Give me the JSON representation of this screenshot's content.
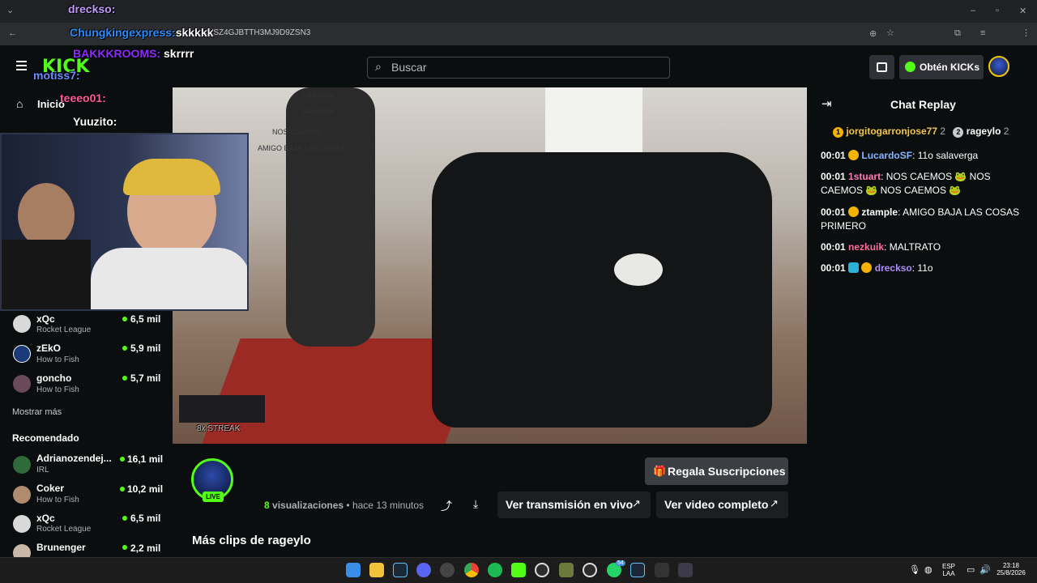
{
  "browser": {
    "url": "...kick.com/rageylo/clips/clip_...VYSZ4GJBTTH3MJ9D9ZSN3",
    "url_visible": "VYSZ4GJBTTH3MJ9D9ZSN3"
  },
  "header": {
    "search_placeholder": "Buscar",
    "kicks_label": "Obtén KICKs"
  },
  "sidebar": {
    "home_label": "Inicio",
    "channels": [
      {
        "name": "xQc",
        "game": "Rocket League",
        "viewers": "6,5 mil"
      },
      {
        "name": "zEkO",
        "game": "How to Fish",
        "viewers": "5,9 mil"
      },
      {
        "name": "goncho",
        "game": "How to Fish",
        "viewers": "5,7 mil"
      }
    ],
    "show_more": "Mostrar más",
    "recommended_title": "Recomendado",
    "recommended": [
      {
        "name": "Adrianozendej...",
        "game": "IRL",
        "viewers": "16,1 mil"
      },
      {
        "name": "Coker",
        "game": "How to Fish",
        "viewers": "10,2 mil"
      },
      {
        "name": "xQc",
        "game": "Rocket League",
        "viewers": "6,5 mil"
      },
      {
        "name": "Brunenger",
        "game": "",
        "viewers": "2,2 mil"
      }
    ]
  },
  "overlay_chat": [
    {
      "user": "drecksо:",
      "msg": "",
      "color": "#c39bff"
    },
    {
      "user": "Chungkingexpress:",
      "msg": "skkkkk",
      "color": "#2a8cff"
    },
    {
      "user": "BAKKKROOMS:",
      "msg": "skrrrr",
      "color": "#8e2bff"
    },
    {
      "user": "motiss7:",
      "msg": "",
      "color": "#6c8cff"
    },
    {
      "user": "teeeo01:",
      "msg": "",
      "color": "#ff5b9a"
    },
    {
      "user": "Yuuzito:",
      "msg": "",
      "color": "#ffffff"
    }
  ],
  "video_overlay": {
    "streak_label": "8x STREAK",
    "chat_lines": [
      "salaverga",
      "salaverga",
      "NOS CAEMOS",
      "AMIGO BAJA LAS COSAS"
    ]
  },
  "clip": {
    "live_badge": "LIVE",
    "gift_label": "Regala Suscripciones",
    "views_count": "8",
    "views_label": "visualizaciones",
    "time_ago": "• hace 13 minutos",
    "watch_live_label": "Ver transmisión en vivo",
    "watch_full_label": "Ver video completo",
    "more_clips_title": "Más clips de rageylo"
  },
  "chat": {
    "title": "Chat Replay",
    "pinned": [
      {
        "rank": "1",
        "user": "jorgitogarronjose77",
        "count": "2"
      },
      {
        "rank": "2",
        "user": "rageylo",
        "count": "2"
      }
    ],
    "messages": [
      {
        "time": "00:01",
        "user": "LucardoSF",
        "text": ": 11o salaverga",
        "color": "#8ab4ff"
      },
      {
        "time": "00:01",
        "user": "1stuart",
        "text": ": NOS CAEMOS 🐸 NOS CAEMOS 🐸 NOS CAEMOS 🐸",
        "color": "#ff7ab8"
      },
      {
        "time": "00:01",
        "user": "ztample",
        "text": ": AMIGO BAJA LAS COSAS PRIMERO",
        "color": "#ffffff"
      },
      {
        "time": "00:01",
        "user": "nezkuik",
        "text": ": MALTRATO",
        "color": "#ff6b9d"
      },
      {
        "time": "00:01",
        "user": "drecksо",
        "text": ": 11o",
        "color": "#b18cff"
      }
    ]
  },
  "taskbar": {
    "lang_top": "ESP",
    "lang_bottom": "LAA",
    "time": "23:18",
    "date": "25/8/2026",
    "badge": "54"
  },
  "colors": {
    "kick_green": "#53fc18",
    "background": "#0b0e0f"
  }
}
